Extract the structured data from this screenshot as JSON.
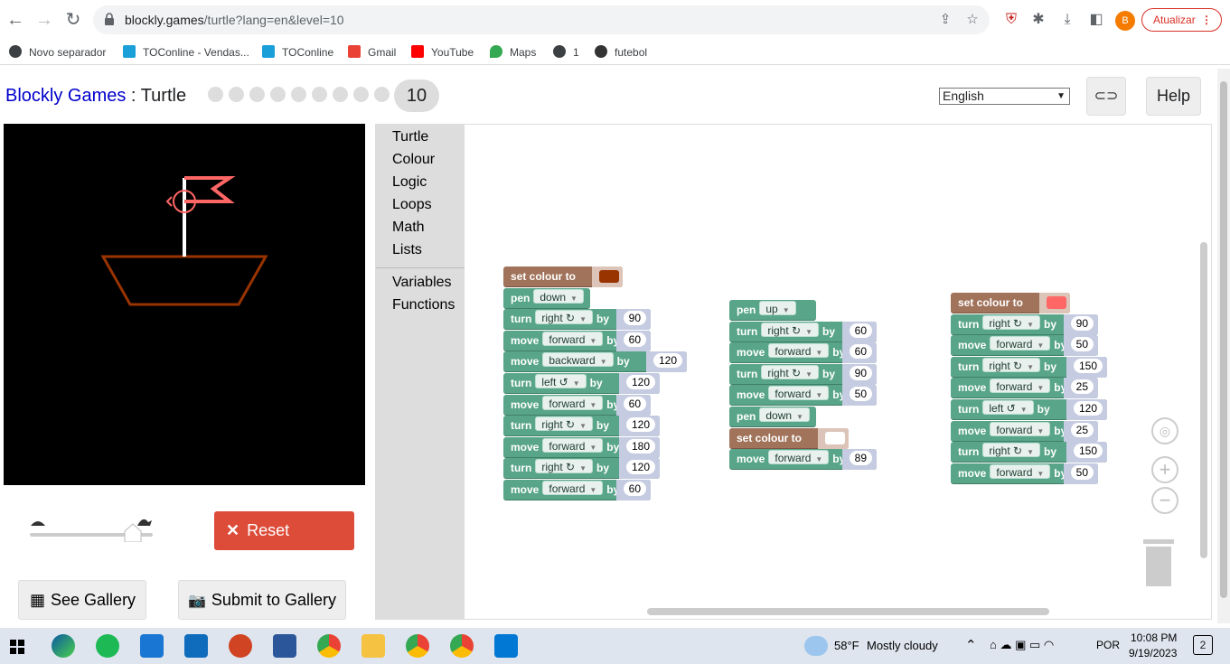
{
  "browser": {
    "url_host": "blockly.games",
    "url_path": "/turtle?lang=en&level=10",
    "update_label": "Atualizar",
    "profile_initial": "B",
    "bookmarks": [
      {
        "label": "Novo separador",
        "icon": "globe-icon",
        "color": "#3c4043"
      },
      {
        "label": "TOConline - Vendas...",
        "icon": "toconline-icon",
        "color": "#1a9fd8"
      },
      {
        "label": "TOConline",
        "icon": "toconline-icon",
        "color": "#1a9fd8"
      },
      {
        "label": "Gmail",
        "icon": "gmail-icon",
        "color": "#ea4335"
      },
      {
        "label": "YouTube",
        "icon": "youtube-icon",
        "color": "#ff0000"
      },
      {
        "label": "Maps",
        "icon": "maps-icon",
        "color": "#34a853"
      },
      {
        "label": "1",
        "icon": "globe-icon",
        "color": "#3c4043"
      },
      {
        "label": "futebol",
        "icon": "football-icon",
        "color": "#333333"
      }
    ]
  },
  "app": {
    "brand": "Blockly Games",
    "separator": " : ",
    "game": "Turtle",
    "level": "10",
    "language": "English",
    "help_label": "Help",
    "reset_label": "Reset",
    "see_gallery_label": "See Gallery",
    "submit_gallery_label": "Submit to Gallery"
  },
  "toolbox": [
    "Turtle",
    "Colour",
    "Logic",
    "Loops",
    "Math",
    "Lists",
    "Variables",
    "Functions"
  ],
  "labels": {
    "set_colour": "set colour to",
    "pen": "pen",
    "turn": "turn",
    "move": "move",
    "by": "by"
  },
  "stack1": [
    {
      "type": "colour",
      "color": "#993300"
    },
    {
      "type": "pen",
      "opt": "down"
    },
    {
      "type": "turn",
      "opt": "right ↻",
      "val": "90"
    },
    {
      "type": "move",
      "opt": "forward",
      "val": "60"
    },
    {
      "type": "move",
      "opt": "backward",
      "val": "120"
    },
    {
      "type": "turn",
      "opt": "left ↺",
      "val": "120"
    },
    {
      "type": "move",
      "opt": "forward",
      "val": "60"
    },
    {
      "type": "turn",
      "opt": "right ↻",
      "val": "120"
    },
    {
      "type": "move",
      "opt": "forward",
      "val": "180"
    },
    {
      "type": "turn",
      "opt": "right ↻",
      "val": "120"
    },
    {
      "type": "move",
      "opt": "forward",
      "val": "60"
    }
  ],
  "stack2": [
    {
      "type": "pen",
      "opt": "up"
    },
    {
      "type": "turn",
      "opt": "right ↻",
      "val": "60"
    },
    {
      "type": "move",
      "opt": "forward",
      "val": "60"
    },
    {
      "type": "turn",
      "opt": "right ↻",
      "val": "90"
    },
    {
      "type": "move",
      "opt": "forward",
      "val": "50"
    },
    {
      "type": "pen",
      "opt": "down"
    },
    {
      "type": "colour",
      "color": "#ffffff"
    },
    {
      "type": "move",
      "opt": "forward",
      "val": "89"
    }
  ],
  "stack3": [
    {
      "type": "colour",
      "color": "#ff6666"
    },
    {
      "type": "turn",
      "opt": "right ↻",
      "val": "90"
    },
    {
      "type": "move",
      "opt": "forward",
      "val": "50"
    },
    {
      "type": "turn",
      "opt": "right ↻",
      "val": "150"
    },
    {
      "type": "move",
      "opt": "forward",
      "val": "25"
    },
    {
      "type": "turn",
      "opt": "left ↺",
      "val": "120"
    },
    {
      "type": "move",
      "opt": "forward",
      "val": "25"
    },
    {
      "type": "turn",
      "opt": "right ↻",
      "val": "150"
    },
    {
      "type": "move",
      "opt": "forward",
      "val": "50"
    }
  ],
  "taskbar": {
    "weather_temp": "58°F",
    "weather_desc": "Mostly cloudy",
    "lang": "POR",
    "time": "10:08 PM",
    "date": "9/19/2023",
    "notifications": "2"
  }
}
